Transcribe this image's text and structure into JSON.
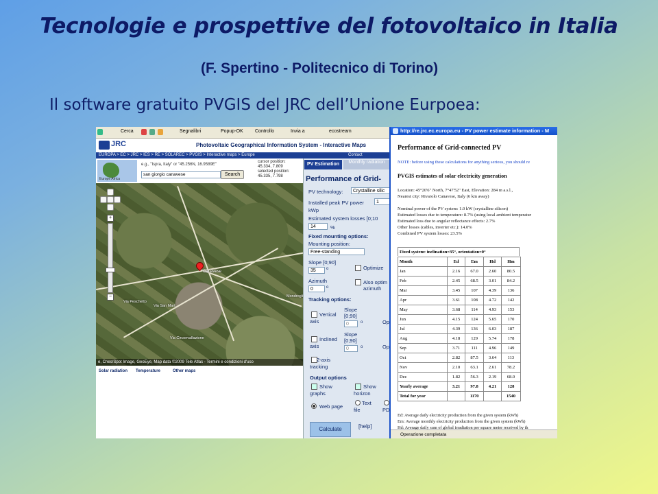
{
  "slide": {
    "title": "Tecnologie e prospettive del fotovoltaico in Italia",
    "subtitle": "(F. Spertino - Politecnico di Torino)",
    "lead": "Il software gratuito PVGIS del JRC dell’Unione Eurpoea:"
  },
  "toolbar": {
    "search": "Cerca",
    "bookmarks": "Segnalibri",
    "popup": "Popup-OK",
    "check": "Controllo",
    "send": "Invia a",
    "ecostream": "ecostream"
  },
  "site": {
    "logo": "JRC",
    "title": "Photovoltaic Geographical Information System - Interactive Maps",
    "breadcrumb": "EUROPA > EC > JRC > IES > RE > SOLAREC > PVGIS > Interactive maps > Europe",
    "contact": "Contact"
  },
  "map": {
    "region_label": "Europe     Africa",
    "hint": "e.g., \"Ispra, Italy\" or \"45.256N, 16.9589E\"",
    "search_value": "san giorgio canavese",
    "search_button": "Search",
    "cursor_position_label": "cursor position:",
    "cursor_position": "45.334, 7.809",
    "selected_position_label": "selected position:",
    "selected_position": "45.335, 7.798",
    "town_label": "Canavese",
    "labels": [
      "Via Peschetto",
      "Via San Mart",
      "Mondroglio",
      "Via Circonvallazione"
    ],
    "footer": "e, Cnes/Spot Image, GeoEye, Map data ©2009 Tele Atlas - Termini e condizioni d'uso",
    "tabs": [
      "Solar radiation",
      "Temperature",
      "Other maps"
    ]
  },
  "pv": {
    "tab_active": "PV Estimation",
    "tab_other": "Monthly radiation",
    "heading": "Performance of Grid-",
    "technology_label": "PV technology:",
    "technology_value": "Crystalline silic",
    "peak_label": "Installed peak PV power",
    "peak_value": "1",
    "peak_unit": "kWp",
    "losses_label": "Estimated system losses [0;10",
    "losses_value": "14",
    "losses_unit": "%",
    "fixed_heading": "Fixed mounting options:",
    "mounting_label": "Mounting position:",
    "mounting_value": "Free-standing",
    "slope_label": "Slope [0;90]",
    "slope_value": "35",
    "deg": "o",
    "optimize_label": "Optimize",
    "azimuth_label": "Azimuth",
    "azimuth_value": "0",
    "also_opt_label": "Also optim azimuth",
    "tracking_heading": "Tracking options:",
    "vertical_axis": "Vertical axis",
    "inclined_axis": "Inclined axis",
    "two_axis": "2-axis tracking",
    "track_slope1": "Slope [0;90]",
    "track_slope1_value": "0",
    "track_slope2": "Slope [0;90]",
    "track_slope2_value": "0",
    "op1": "Op",
    "op2": "Op",
    "output_heading": "Output options",
    "show_graphs": "Show graphs",
    "show_horizon": "Show horizon",
    "web_page": "Web page",
    "text_file": "Text file",
    "pdf": "PD",
    "calculate": "Calculate",
    "help": "[help]"
  },
  "popup": {
    "titlebar": "http://re.jrc.ec.europa.eu - PV power estimate information - M",
    "title": "Performance of Grid-connected PV",
    "note": "NOTE: before using these calculations for anything serious, you should re",
    "estimates_title": "PVGIS estimates of solar electricity generation",
    "location": "Location: 45°20'6\" North, 7°47'52\" East, Elevation: 284 m a.s.l.,",
    "nearest_city": "Nearest city: Rivarolo Canavese, Italy (6 km away)",
    "nominal_power": "Nominal power of the PV system: 1.0 kW (crystalline silicon)",
    "loss_temp": "Estimated losses due to temperature: 8.7% (using local ambient temperatur",
    "loss_angular": "Estimated loss due to angular reflectance effects: 2.7%",
    "loss_other": "Other losses (cables, inverter etc.): 14.0%",
    "loss_combined": "Combined PV system losses: 23.5%",
    "table_caption": "Fixed system: inclination=35°, orientation=0°",
    "table_headers": [
      "Month",
      "Ed",
      "Em",
      "Hd",
      "Hm"
    ],
    "rows": [
      [
        "Jan",
        "2.16",
        "67.0",
        "2.60",
        "80.5"
      ],
      [
        "Feb",
        "2.45",
        "68.5",
        "3.01",
        "84.2"
      ],
      [
        "Mar",
        "3.45",
        "107",
        "4.39",
        "136"
      ],
      [
        "Apr",
        "3.61",
        "108",
        "4.72",
        "142"
      ],
      [
        "May",
        "3.68",
        "114",
        "4.93",
        "153"
      ],
      [
        "Jun",
        "4.15",
        "124",
        "5.65",
        "170"
      ],
      [
        "Jul",
        "4.39",
        "136",
        "6.03",
        "187"
      ],
      [
        "Aug",
        "4.18",
        "129",
        "5.74",
        "178"
      ],
      [
        "Sep",
        "3.71",
        "111",
        "4.96",
        "149"
      ],
      [
        "Oct",
        "2.82",
        "87.5",
        "3.64",
        "113"
      ],
      [
        "Nov",
        "2.10",
        "63.1",
        "2.61",
        "78.2"
      ],
      [
        "Dec",
        "1.82",
        "56.3",
        "2.19",
        "68.0"
      ]
    ],
    "yearly": [
      "Yearly average",
      "3.21",
      "97.8",
      "4.21",
      "128"
    ],
    "total": [
      "Total for year",
      "",
      "1170",
      "",
      "1540"
    ],
    "legend": [
      "Ed: Average daily electricity production from the given system (kWh)",
      "Em: Average monthly electricity production from the given system (kWh)",
      "Hd: Average daily sum of global irradiation per square meter received by th"
    ],
    "status": "Operazione completata"
  },
  "colors": {
    "title": "#0d1a66",
    "jrc_blue": "#1c3f94",
    "note_blue": "#1642c8"
  }
}
